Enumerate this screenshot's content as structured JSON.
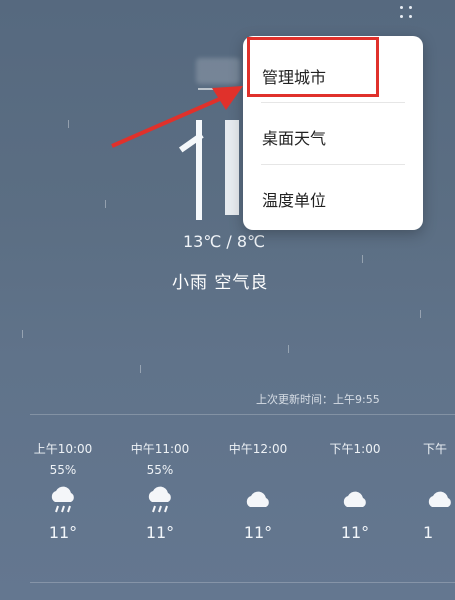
{
  "header": {
    "more_icon": "more-dots-icon",
    "city_name_obscured": true
  },
  "current": {
    "temp_range": "13℃ / 8℃",
    "condition": "小雨 空气良"
  },
  "menu": {
    "items": [
      {
        "label": "管理城市",
        "highlighted": true
      },
      {
        "label": "桌面天气"
      },
      {
        "label": "温度单位"
      }
    ]
  },
  "updated": "上次更新时间：上午9:55",
  "hourly": [
    {
      "time": "上午10:00",
      "pop": "55%",
      "icon": "rain-cloud-icon",
      "temp": "11°"
    },
    {
      "time": "中午11:00",
      "pop": "55%",
      "icon": "rain-cloud-icon",
      "temp": "11°"
    },
    {
      "time": "中午12:00",
      "pop": "",
      "icon": "cloud-icon",
      "temp": "11°"
    },
    {
      "time": "下午1:00",
      "pop": "",
      "icon": "cloud-icon",
      "temp": "11°"
    },
    {
      "time": "下午",
      "pop": "",
      "icon": "cloud-icon",
      "temp": "1"
    }
  ],
  "colors": {
    "background": "#5b6e83",
    "highlight": "#e0312b",
    "menu_bg": "#ffffff"
  }
}
